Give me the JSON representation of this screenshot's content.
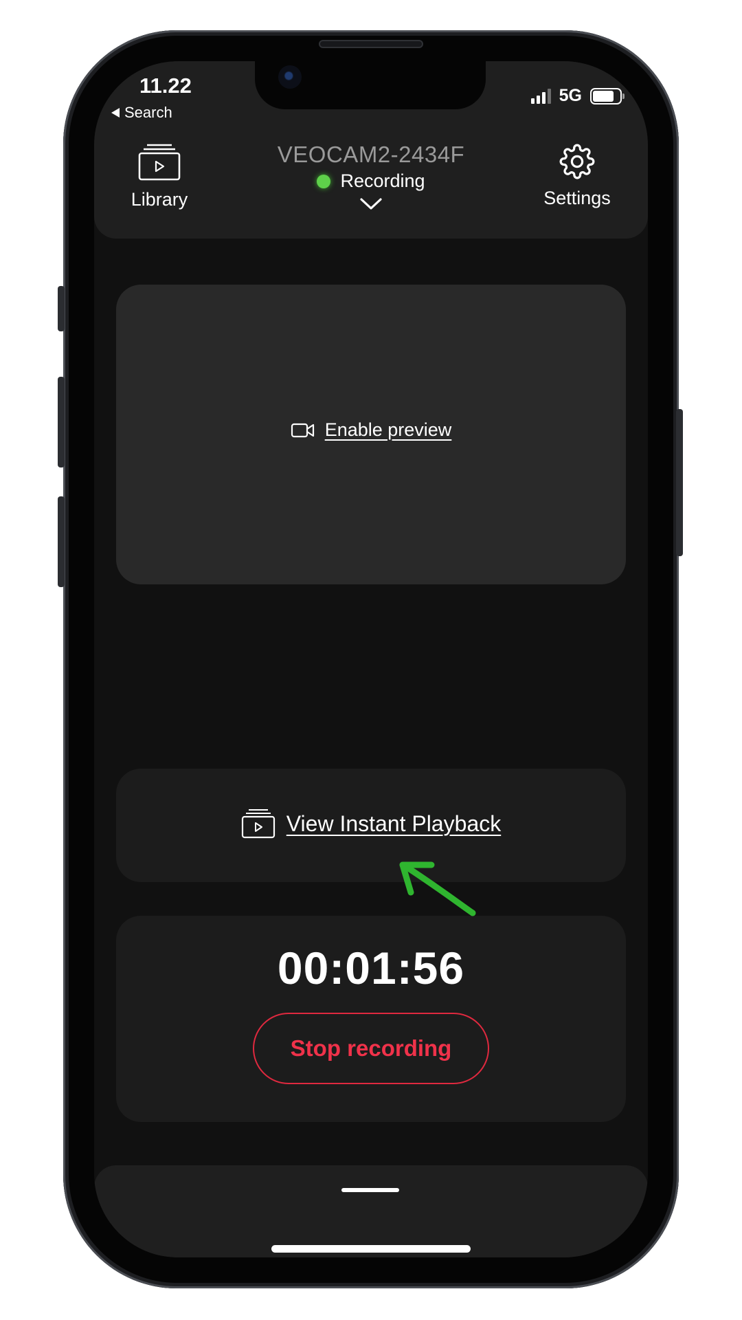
{
  "status_bar": {
    "time": "11.22",
    "back_label": "Search",
    "network": "5G"
  },
  "header": {
    "library_label": "Library",
    "device_name": "VEOCAM2-2434F",
    "device_status": "Recording",
    "settings_label": "Settings"
  },
  "preview": {
    "link_label": "Enable preview"
  },
  "playback": {
    "link_label": "View Instant Playback"
  },
  "recording": {
    "timer": "00:01:56",
    "stop_label": "Stop recording"
  },
  "colors": {
    "background": "#111111",
    "card": "#1c1c1c",
    "preview_card": "#292929",
    "recording_dot": "#5ed04a",
    "stop_red": "#e0293f",
    "annotation_arrow": "#2fb52f"
  },
  "icons": {
    "library": "library-icon",
    "settings": "gear-icon",
    "chevron": "chevron-down-icon",
    "preview": "video-camera-icon",
    "playback": "playback-icon"
  }
}
